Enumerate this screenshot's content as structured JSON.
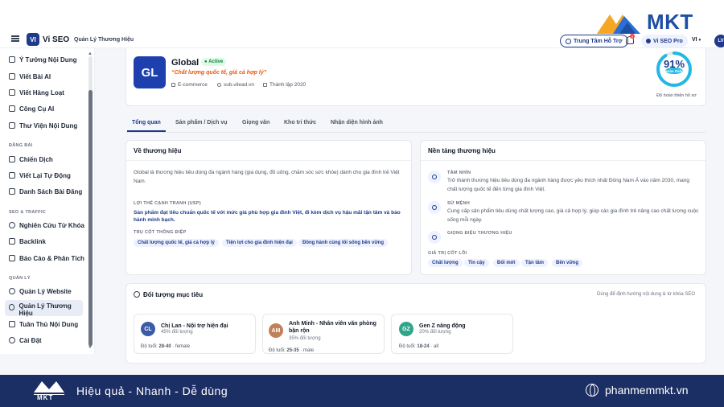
{
  "header": {
    "app_icon": "VI",
    "app_name": "Vi SEO",
    "breadcrumb": "Quản Lý Thương Hiệu",
    "brand_logo": "MKT",
    "support_button": "Trung Tâm Hỗ Trợ",
    "notification_count": "9",
    "pro_button": "Vi SEO Pro",
    "language": "VI",
    "avatar_initials": "LV"
  },
  "sidebar": {
    "items_top": [
      "Ý Tưởng Nội Dung",
      "Viết Bài AI",
      "Viết Hàng Loạt",
      "Công Cụ AI",
      "Thư Viện Nội Dung"
    ],
    "section_campaign": "ĐĂNG BÀI",
    "items_campaign": [
      "Chiến Dịch",
      "Viết Lại Tự Động",
      "Danh Sách Bài Đăng"
    ],
    "section_seo": "SEO & TRAFFIC",
    "items_seo": [
      "Nghiên Cứu Từ Khóa",
      "Backlink",
      "Báo Cáo & Phân Tích"
    ],
    "section_manage": "QUẢN LÝ",
    "items_manage": [
      "Quản Lý Website",
      "Quản Lý Thương Hiệu",
      "Tuân Thủ Nội Dung",
      "Cài Đặt"
    ]
  },
  "brand": {
    "logo_initials": "GL",
    "name": "Global",
    "status": "Active",
    "slogan": "“Chất lượng quốc tế, giá cả hợp lý”",
    "industry": "E-commerce",
    "website": "sub.vilead.vn",
    "founded": "Thành lập 2020",
    "completion_value": "91%",
    "completion_fraction": 0.91,
    "completion_label": "Hoàn thiện",
    "completion_caption": "Độ hoàn thiện hồ sơ"
  },
  "tabs": [
    "Tổng quan",
    "Sản phẩm / Dịch vụ",
    "Giọng văn",
    "Kho tri thức",
    "Nhận diện hình ảnh"
  ],
  "about": {
    "title": "Về thương hiệu",
    "description": "Global là thương hiệu tiêu dùng đa ngành hàng (gia dụng, đồ uống, chăm sóc sức khỏe) dành cho gia đình trẻ Việt Nam.",
    "usp_label": "LỢI THẾ CẠNH TRANH (USP)",
    "usp_text": "Sản phẩm đạt tiêu chuẩn quốc tế với mức giá phù hợp gia đình Việt, đi kèm dịch vụ hậu mãi tận tâm và bảo hành minh bạch.",
    "pillars_label": "TRỤ CỘT THÔNG ĐIỆP",
    "pillars": [
      "Chất lượng quốc tế, giá cả hợp lý",
      "Tiện lợi cho gia đình hiện đại",
      "Đồng hành cùng lối sống bền vững"
    ]
  },
  "foundation": {
    "title": "Nền tảng thương hiệu",
    "vision_label": "TẦM NHÌN",
    "vision_text": "Trở thành thương hiệu tiêu dùng đa ngành hàng được yêu thích nhất Đông Nam Á vào năm 2030, mang chất lượng quốc tế đến từng gia đình Việt.",
    "mission_label": "SỨ MỆNH",
    "mission_text": "Cung cấp sản phẩm tiêu dùng chất lượng cao, giá cả hợp lý, giúp các gia đình trẻ nâng cao chất lượng cuộc sống mỗi ngày.",
    "tone_label": "GIỌNG ĐIỆU THƯƠNG HIỆU",
    "values_label": "GIÁ TRỊ CỐT LÕI",
    "values": [
      "Chất lượng",
      "Tin cậy",
      "Đổi mới",
      "Tận tâm",
      "Bền vững"
    ]
  },
  "audience": {
    "title": "Đối tượng mục tiêu",
    "hint": "Dùng để định hướng nội dung & từ khóa SEO",
    "personas": [
      {
        "initials": "CL",
        "name": "Chị Lan - Nội trợ hiện đại",
        "share": "45% đối tượng",
        "age_label": "Độ tuổi:",
        "age": "28-40",
        "gender": "· female"
      },
      {
        "initials": "AM",
        "name": "Anh Minh - Nhân viên văn phòng bận rộn",
        "share": "35% đối tượng",
        "age_label": "Độ tuổi:",
        "age": "25-35",
        "gender": "· male"
      },
      {
        "initials": "GZ",
        "name": "Gen Z năng động",
        "share": "20% đối tượng",
        "age_label": "Độ tuổi:",
        "age": "18-24",
        "gender": "· all"
      }
    ]
  },
  "footer": {
    "logo": "MKT",
    "slogan": "Hiệu quả - Nhanh - Dễ dùng",
    "website": "phanmemmkt.vn"
  },
  "colors": {
    "primary": "#1e3a8a",
    "accent_orange": "#ea580c",
    "active_green": "#15803d",
    "footer_bg": "#1c2f64",
    "ring_cyan": "#22b8e6"
  }
}
